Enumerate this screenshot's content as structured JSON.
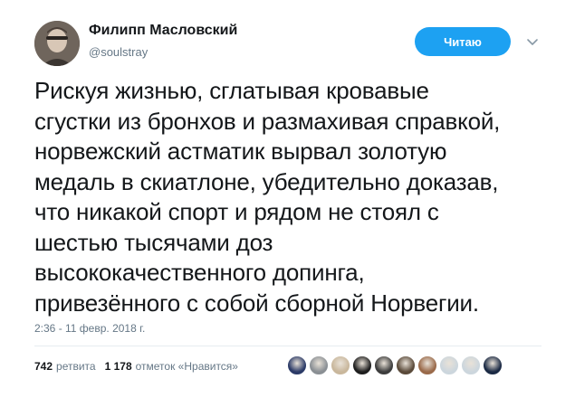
{
  "author": {
    "display_name": "Филипп Масловский",
    "screen_name": "@soulstray",
    "avatar_icon": "user-avatar-photo"
  },
  "follow_button": {
    "label": "Читаю",
    "color": "#1da1f2"
  },
  "menu_icon": "chevron-down-icon",
  "tweet": {
    "lines": [
      "Рискуя жизнью, сглатывая кровавые",
      "сгустки из бронхов и размахивая справкой,",
      "норвежский астматик вырвал золотую",
      "медаль в скиатлоне, убедительно доказав,",
      "что никакой спорт и рядом не стоял с",
      "шестью тысячами доз",
      "высококачественного допинга,",
      "привезённого с собой сборной Норвегии."
    ]
  },
  "timestamp": "2:36 - 11 февр. 2018 г.",
  "stats": {
    "retweets_count": "742",
    "retweets_label": "ретвита",
    "likes_count": "1 178",
    "likes_label": "отметок «Нравится»"
  },
  "likers": [
    {
      "icon": "liker-avatar-1",
      "color": "#2b3a67"
    },
    {
      "icon": "liker-avatar-2",
      "color": "#8a8f94"
    },
    {
      "icon": "liker-avatar-3",
      "color": "#c9b79c"
    },
    {
      "icon": "liker-avatar-4",
      "color": "#1e1e1e"
    },
    {
      "icon": "liker-avatar-5",
      "color": "#3d3d3d"
    },
    {
      "icon": "liker-avatar-6",
      "color": "#5a4a3a"
    },
    {
      "icon": "liker-avatar-7",
      "color": "#9a6a4a"
    },
    {
      "icon": "liker-avatar-8",
      "color": "#ccd6dd"
    },
    {
      "icon": "liker-avatar-9",
      "color": "#ccd6dd"
    },
    {
      "icon": "liker-avatar-10",
      "color": "#1b2a44"
    }
  ]
}
